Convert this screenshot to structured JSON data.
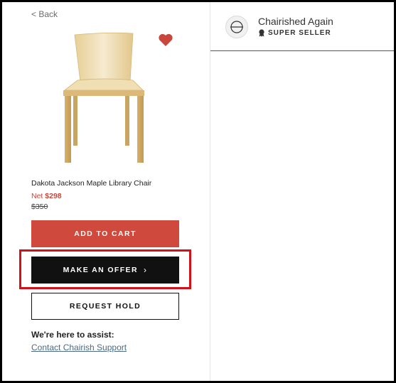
{
  "nav": {
    "back_label": "< Back"
  },
  "product": {
    "title": "Dakota Jackson Maple Library Chair",
    "net_label": "Net",
    "net_price": "$298",
    "original_price": "$350"
  },
  "actions": {
    "add_to_cart": "ADD TO CART",
    "make_offer": "MAKE AN OFFER",
    "request_hold": "REQUEST HOLD"
  },
  "assist": {
    "heading": "We're here to assist:",
    "link": "Contact Chairish Support"
  },
  "seller": {
    "name": "Chairished Again",
    "badge": "SUPER SELLER"
  },
  "colors": {
    "accent_red": "#cf493c",
    "heart_red": "#c8463b",
    "highlight_red": "#d0121b",
    "dark": "#111111",
    "link_blue": "#4b6a86"
  }
}
